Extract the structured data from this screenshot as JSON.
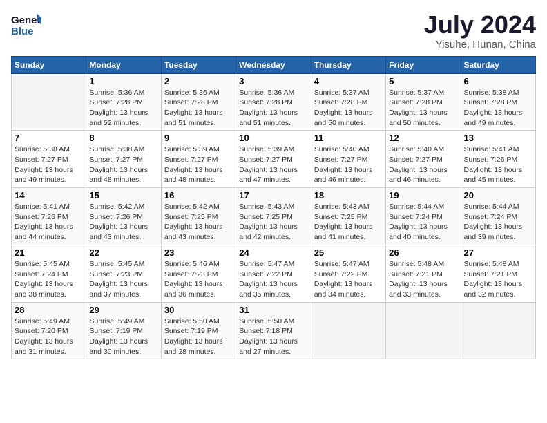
{
  "header": {
    "logo_line1": "General",
    "logo_line2": "Blue",
    "title": "July 2024",
    "location": "Yisuhe, Hunan, China"
  },
  "days_of_week": [
    "Sunday",
    "Monday",
    "Tuesday",
    "Wednesday",
    "Thursday",
    "Friday",
    "Saturday"
  ],
  "weeks": [
    [
      {
        "day": null,
        "sunrise": null,
        "sunset": null,
        "daylight": null
      },
      {
        "day": "1",
        "sunrise": "5:36 AM",
        "sunset": "7:28 PM",
        "daylight": "13 hours and 52 minutes."
      },
      {
        "day": "2",
        "sunrise": "5:36 AM",
        "sunset": "7:28 PM",
        "daylight": "13 hours and 51 minutes."
      },
      {
        "day": "3",
        "sunrise": "5:36 AM",
        "sunset": "7:28 PM",
        "daylight": "13 hours and 51 minutes."
      },
      {
        "day": "4",
        "sunrise": "5:37 AM",
        "sunset": "7:28 PM",
        "daylight": "13 hours and 50 minutes."
      },
      {
        "day": "5",
        "sunrise": "5:37 AM",
        "sunset": "7:28 PM",
        "daylight": "13 hours and 50 minutes."
      },
      {
        "day": "6",
        "sunrise": "5:38 AM",
        "sunset": "7:28 PM",
        "daylight": "13 hours and 49 minutes."
      }
    ],
    [
      {
        "day": "7",
        "sunrise": "5:38 AM",
        "sunset": "7:27 PM",
        "daylight": "13 hours and 49 minutes."
      },
      {
        "day": "8",
        "sunrise": "5:38 AM",
        "sunset": "7:27 PM",
        "daylight": "13 hours and 48 minutes."
      },
      {
        "day": "9",
        "sunrise": "5:39 AM",
        "sunset": "7:27 PM",
        "daylight": "13 hours and 48 minutes."
      },
      {
        "day": "10",
        "sunrise": "5:39 AM",
        "sunset": "7:27 PM",
        "daylight": "13 hours and 47 minutes."
      },
      {
        "day": "11",
        "sunrise": "5:40 AM",
        "sunset": "7:27 PM",
        "daylight": "13 hours and 46 minutes."
      },
      {
        "day": "12",
        "sunrise": "5:40 AM",
        "sunset": "7:27 PM",
        "daylight": "13 hours and 46 minutes."
      },
      {
        "day": "13",
        "sunrise": "5:41 AM",
        "sunset": "7:26 PM",
        "daylight": "13 hours and 45 minutes."
      }
    ],
    [
      {
        "day": "14",
        "sunrise": "5:41 AM",
        "sunset": "7:26 PM",
        "daylight": "13 hours and 44 minutes."
      },
      {
        "day": "15",
        "sunrise": "5:42 AM",
        "sunset": "7:26 PM",
        "daylight": "13 hours and 43 minutes."
      },
      {
        "day": "16",
        "sunrise": "5:42 AM",
        "sunset": "7:25 PM",
        "daylight": "13 hours and 43 minutes."
      },
      {
        "day": "17",
        "sunrise": "5:43 AM",
        "sunset": "7:25 PM",
        "daylight": "13 hours and 42 minutes."
      },
      {
        "day": "18",
        "sunrise": "5:43 AM",
        "sunset": "7:25 PM",
        "daylight": "13 hours and 41 minutes."
      },
      {
        "day": "19",
        "sunrise": "5:44 AM",
        "sunset": "7:24 PM",
        "daylight": "13 hours and 40 minutes."
      },
      {
        "day": "20",
        "sunrise": "5:44 AM",
        "sunset": "7:24 PM",
        "daylight": "13 hours and 39 minutes."
      }
    ],
    [
      {
        "day": "21",
        "sunrise": "5:45 AM",
        "sunset": "7:24 PM",
        "daylight": "13 hours and 38 minutes."
      },
      {
        "day": "22",
        "sunrise": "5:45 AM",
        "sunset": "7:23 PM",
        "daylight": "13 hours and 37 minutes."
      },
      {
        "day": "23",
        "sunrise": "5:46 AM",
        "sunset": "7:23 PM",
        "daylight": "13 hours and 36 minutes."
      },
      {
        "day": "24",
        "sunrise": "5:47 AM",
        "sunset": "7:22 PM",
        "daylight": "13 hours and 35 minutes."
      },
      {
        "day": "25",
        "sunrise": "5:47 AM",
        "sunset": "7:22 PM",
        "daylight": "13 hours and 34 minutes."
      },
      {
        "day": "26",
        "sunrise": "5:48 AM",
        "sunset": "7:21 PM",
        "daylight": "13 hours and 33 minutes."
      },
      {
        "day": "27",
        "sunrise": "5:48 AM",
        "sunset": "7:21 PM",
        "daylight": "13 hours and 32 minutes."
      }
    ],
    [
      {
        "day": "28",
        "sunrise": "5:49 AM",
        "sunset": "7:20 PM",
        "daylight": "13 hours and 31 minutes."
      },
      {
        "day": "29",
        "sunrise": "5:49 AM",
        "sunset": "7:19 PM",
        "daylight": "13 hours and 30 minutes."
      },
      {
        "day": "30",
        "sunrise": "5:50 AM",
        "sunset": "7:19 PM",
        "daylight": "13 hours and 28 minutes."
      },
      {
        "day": "31",
        "sunrise": "5:50 AM",
        "sunset": "7:18 PM",
        "daylight": "13 hours and 27 minutes."
      },
      {
        "day": null,
        "sunrise": null,
        "sunset": null,
        "daylight": null
      },
      {
        "day": null,
        "sunrise": null,
        "sunset": null,
        "daylight": null
      },
      {
        "day": null,
        "sunrise": null,
        "sunset": null,
        "daylight": null
      }
    ]
  ],
  "labels": {
    "sunrise": "Sunrise:",
    "sunset": "Sunset:",
    "daylight": "Daylight:"
  }
}
